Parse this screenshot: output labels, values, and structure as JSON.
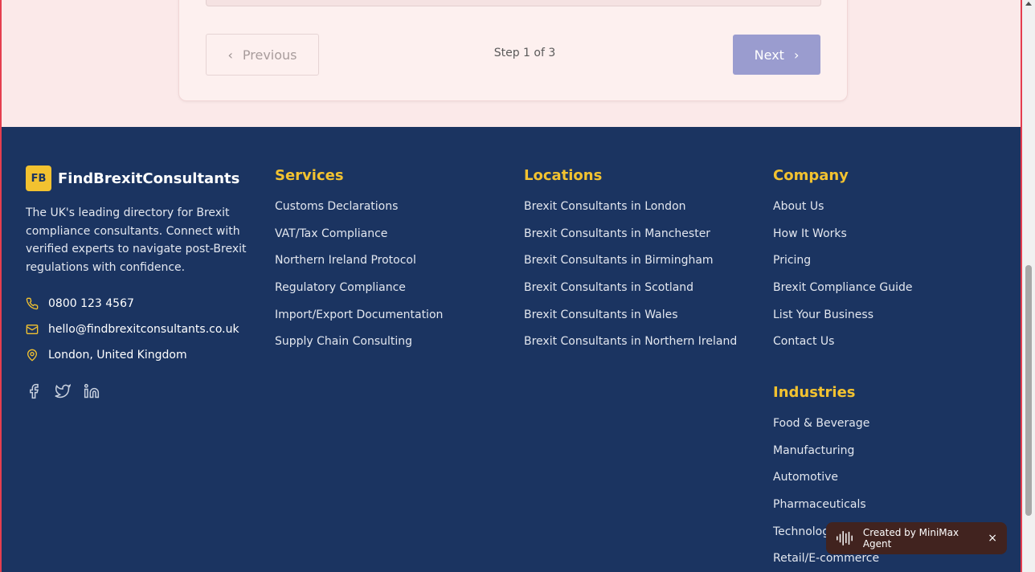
{
  "pagination": {
    "prev_label": "Previous",
    "next_label": "Next",
    "step_text": "Step 1 of 3"
  },
  "brand": {
    "logo_text": "FB",
    "name": "FindBrexitConsultants",
    "description": "The UK's leading directory for Brexit compliance consultants. Connect with verified experts to navigate post-Brexit regulations with confidence."
  },
  "contact": {
    "phone": "0800 123 4567",
    "email": "hello@findbrexitconsultants.co.uk",
    "location": "London, United Kingdom"
  },
  "socials": [
    "facebook-icon",
    "twitter-icon",
    "linkedin-icon"
  ],
  "services": {
    "title": "Services",
    "items": [
      "Customs Declarations",
      "VAT/Tax Compliance",
      "Northern Ireland Protocol",
      "Regulatory Compliance",
      "Import/Export Documentation",
      "Supply Chain Consulting"
    ]
  },
  "locations": {
    "title": "Locations",
    "items": [
      "Brexit Consultants in London",
      "Brexit Consultants in Manchester",
      "Brexit Consultants in Birmingham",
      "Brexit Consultants in Scotland",
      "Brexit Consultants in Wales",
      "Brexit Consultants in Northern Ireland"
    ]
  },
  "company": {
    "title": "Company",
    "items": [
      "About Us",
      "How It Works",
      "Pricing",
      "Brexit Compliance Guide",
      "List Your Business",
      "Contact Us"
    ]
  },
  "industries": {
    "title": "Industries",
    "items": [
      "Food & Beverage",
      "Manufacturing",
      "Automotive",
      "Pharmaceuticals",
      "Technology",
      "Retail/E-commerce"
    ]
  },
  "badge": {
    "text": "Created by MiniMax Agent",
    "close": "×"
  },
  "colors": {
    "footer_bg": "#1b3461",
    "accent": "#f2c230",
    "next_button": "#9a9ccf"
  }
}
